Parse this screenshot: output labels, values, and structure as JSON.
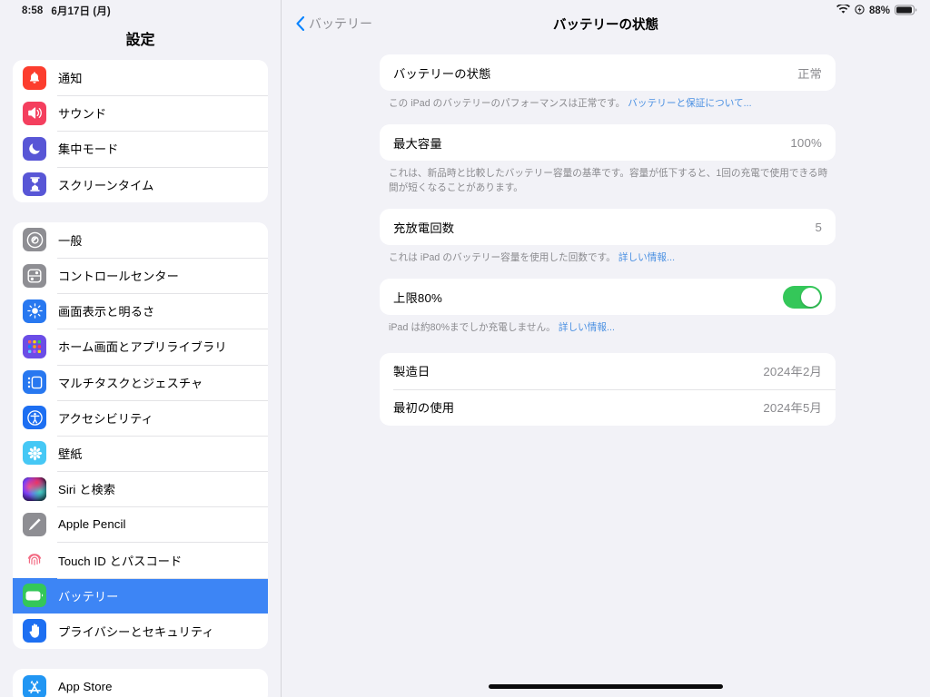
{
  "status_bar": {
    "time": "8:58",
    "date": "6月17日 (月)",
    "wifi_icon": "wifi-icon",
    "charge_limit_icon": "charge-limit-icon",
    "battery_percent": "88%",
    "battery_icon": "battery-icon"
  },
  "sidebar": {
    "title": "設定",
    "groups": [
      {
        "items": [
          {
            "label": "通知",
            "icon": "bell-icon",
            "color": "#fc3d2e",
            "selected": false
          },
          {
            "label": "サウンド",
            "icon": "speaker-icon",
            "color": "#f43f5e",
            "selected": false
          },
          {
            "label": "集中モード",
            "icon": "moon-icon",
            "color": "#5856d6",
            "selected": false
          },
          {
            "label": "スクリーンタイム",
            "icon": "hourglass-icon",
            "color": "#5856d6",
            "selected": false
          }
        ]
      },
      {
        "items": [
          {
            "label": "一般",
            "icon": "gear-icon",
            "color": "#8e8e93",
            "selected": false
          },
          {
            "label": "コントロールセンター",
            "icon": "control-center-icon",
            "color": "#8e8e93",
            "selected": false
          },
          {
            "label": "画面表示と明るさ",
            "icon": "brightness-icon",
            "color": "#2878f0",
            "selected": false
          },
          {
            "label": "ホーム画面とアプリライブラリ",
            "icon": "app-grid-icon",
            "color": "#6b4de6",
            "selected": false
          },
          {
            "label": "マルチタスクとジェスチャ",
            "icon": "multitask-icon",
            "color": "#2878f0",
            "selected": false
          },
          {
            "label": "アクセシビリティ",
            "icon": "accessibility-icon",
            "color": "#1d6ff2",
            "selected": false
          },
          {
            "label": "壁紙",
            "icon": "wallpaper-icon",
            "color": "#46c8f5",
            "selected": false
          },
          {
            "label": "Siri と検索",
            "icon": "siri-icon",
            "color": "#2a1b3d",
            "selected": false
          },
          {
            "label": "Apple Pencil",
            "icon": "pencil-icon",
            "color": "#8e8e93",
            "selected": false
          },
          {
            "label": "Touch ID とパスコード",
            "icon": "touch-id-icon",
            "color": "#ffffff",
            "selected": false
          },
          {
            "label": "バッテリー",
            "icon": "battery-icon",
            "color": "#34c759",
            "selected": true
          },
          {
            "label": "プライバシーとセキュリティ",
            "icon": "hand-raised-icon",
            "color": "#1d6ff2",
            "selected": false
          }
        ]
      },
      {
        "items": [
          {
            "label": "App Store",
            "icon": "app-store-icon",
            "color": "#2196f3",
            "selected": false
          }
        ]
      }
    ]
  },
  "detail": {
    "back_label": "バッテリー",
    "title": "バッテリーの状態",
    "sections": [
      {
        "rows": [
          {
            "label": "バッテリーの状態",
            "value": "正常",
            "type": "value"
          }
        ],
        "footnote_text": "この iPad のバッテリーのパフォーマンスは正常です。",
        "footnote_link": "バッテリーと保証について..."
      },
      {
        "rows": [
          {
            "label": "最大容量",
            "value": "100%",
            "type": "value"
          }
        ],
        "footnote_text": "これは、新品時と比較したバッテリー容量の基準です。容量が低下すると、1回の充電で使用できる時間が短くなることがあります。",
        "footnote_link": ""
      },
      {
        "rows": [
          {
            "label": "充放電回数",
            "value": "5",
            "type": "value"
          }
        ],
        "footnote_text": "これは iPad のバッテリー容量を使用した回数です。",
        "footnote_link": "詳しい情報..."
      },
      {
        "rows": [
          {
            "label": "上限80%",
            "value": "",
            "type": "toggle",
            "toggle_on": true
          }
        ],
        "footnote_text": "iPad は約80%までしか充電しません。",
        "footnote_link": "詳しい情報..."
      },
      {
        "rows": [
          {
            "label": "製造日",
            "value": "2024年2月",
            "type": "value"
          },
          {
            "label": "最初の使用",
            "value": "2024年5月",
            "type": "value"
          }
        ],
        "footnote_text": "",
        "footnote_link": ""
      }
    ]
  },
  "colors": {
    "accent_blue": "#0a84ff",
    "selected_row": "#3d85f5",
    "toggle_green": "#34c759",
    "link_blue": "#4a90e2"
  }
}
